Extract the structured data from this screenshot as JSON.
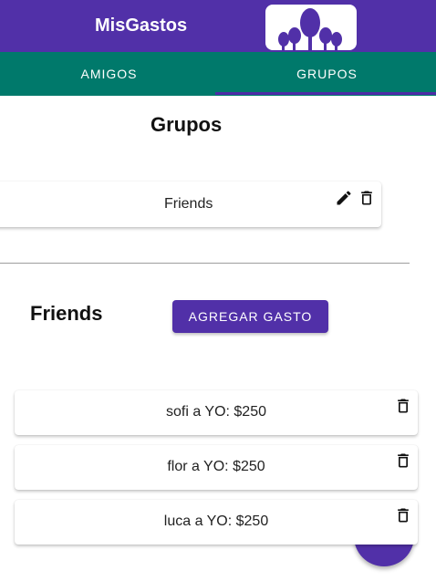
{
  "app": {
    "title": "MisGastos"
  },
  "colors": {
    "primary": "#5130a8",
    "tabs": "#00796b"
  },
  "tabs": [
    {
      "label": "AMIGOS",
      "active": false
    },
    {
      "label": "GRUPOS",
      "active": true
    }
  ],
  "groups_section": {
    "title": "Grupos",
    "groups": [
      {
        "name": "Friends"
      }
    ]
  },
  "group_detail": {
    "title": "Friends",
    "add_button_label": "AGREGAR GASTO",
    "expenses": [
      {
        "text": "sofi a YO: $250"
      },
      {
        "text": "flor a YO: $250"
      },
      {
        "text": "luca a YO: $250"
      }
    ]
  },
  "icons": {
    "logo": "people-logo",
    "edit": "pencil-icon",
    "delete": "trash-icon",
    "fab": "add-fab"
  }
}
